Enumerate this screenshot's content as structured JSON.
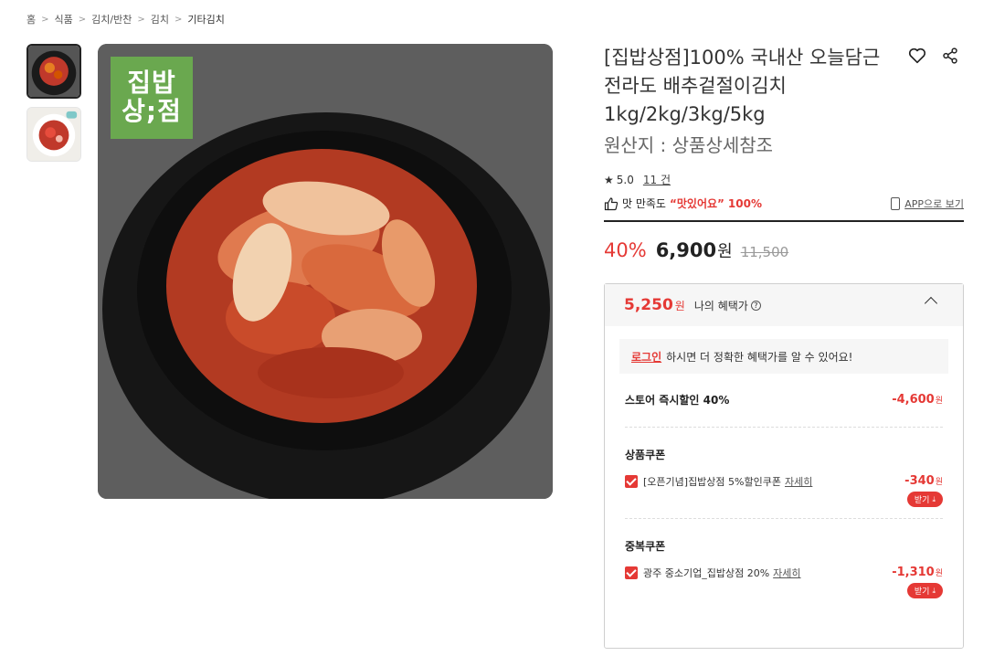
{
  "breadcrumb": [
    "홈",
    "식품",
    "김치/반찬",
    "김치",
    "기타김치"
  ],
  "brand_badge": {
    "line1": "집밥",
    "line2": "상;점"
  },
  "product": {
    "title": "[집밥상점]100% 국내산 오늘담근 전라도 배추겉절이김치 1kg/2kg/3kg/5kg",
    "origin": "원산지 : 상품상세참조",
    "rating": "5.0",
    "review_count": "11 건",
    "satisfaction_prefix": "맛 만족도",
    "satisfaction_highlight": "“맛있어요”",
    "satisfaction_pct": "100%",
    "app_link": "APP으로 보기"
  },
  "price": {
    "discount": "40%",
    "sale": "6,900",
    "won": "원",
    "original": "11,500"
  },
  "benefit": {
    "price": "5,250",
    "won": "원",
    "label": "나의 혜택가",
    "help": "?",
    "login_link": "로그인",
    "login_text": "하시면 더 정확한 혜택가를 알 수 있어요!",
    "store_discount_label": "스토어 즉시할인 40%",
    "store_discount_amount": "-4,600",
    "product_coupon_title": "상품쿠폰",
    "product_coupon": {
      "label": "[오픈기념]집밥상점 5%할인쿠폰",
      "detail": "자세히",
      "amount": "-340",
      "get": "받기"
    },
    "dup_coupon_title": "중복쿠폰",
    "dup_coupon": {
      "label": "광주 중소기업_집밥상점 20%",
      "detail": "자세히",
      "amount": "-1,310",
      "get": "받기"
    }
  },
  "colors": {
    "accent": "#e53935",
    "brand_green": "#6aa84f"
  }
}
